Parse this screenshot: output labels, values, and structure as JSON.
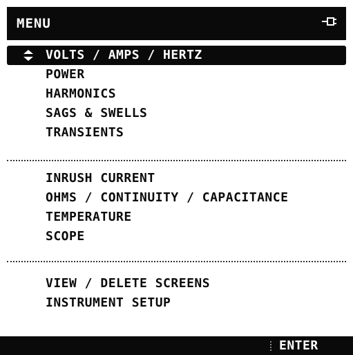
{
  "header": {
    "title": "MENU",
    "power_icon": "power-plug-icon"
  },
  "menu": {
    "selection_icon": "up-down-arrows-icon",
    "groups": [
      {
        "items": [
          {
            "label": "VOLTS / AMPS / HERTZ",
            "selected": true
          },
          {
            "label": "POWER",
            "selected": false
          },
          {
            "label": "HARMONICS",
            "selected": false
          },
          {
            "label": "SAGS & SWELLS",
            "selected": false
          },
          {
            "label": "TRANSIENTS",
            "selected": false
          }
        ]
      },
      {
        "items": [
          {
            "label": "INRUSH CURRENT",
            "selected": false
          },
          {
            "label": "OHMS / CONTINUITY / CAPACITANCE",
            "selected": false
          },
          {
            "label": "TEMPERATURE",
            "selected": false
          },
          {
            "label": "SCOPE",
            "selected": false
          }
        ]
      },
      {
        "items": [
          {
            "label": "VIEW / DELETE SCREENS",
            "selected": false
          },
          {
            "label": "INSTRUMENT SETUP",
            "selected": false
          }
        ]
      }
    ]
  },
  "footer": {
    "enter_label": "ENTER"
  },
  "colors": {
    "background": "#ffffff",
    "foreground": "#0a0a0a",
    "highlight_text": "#ffffff"
  }
}
